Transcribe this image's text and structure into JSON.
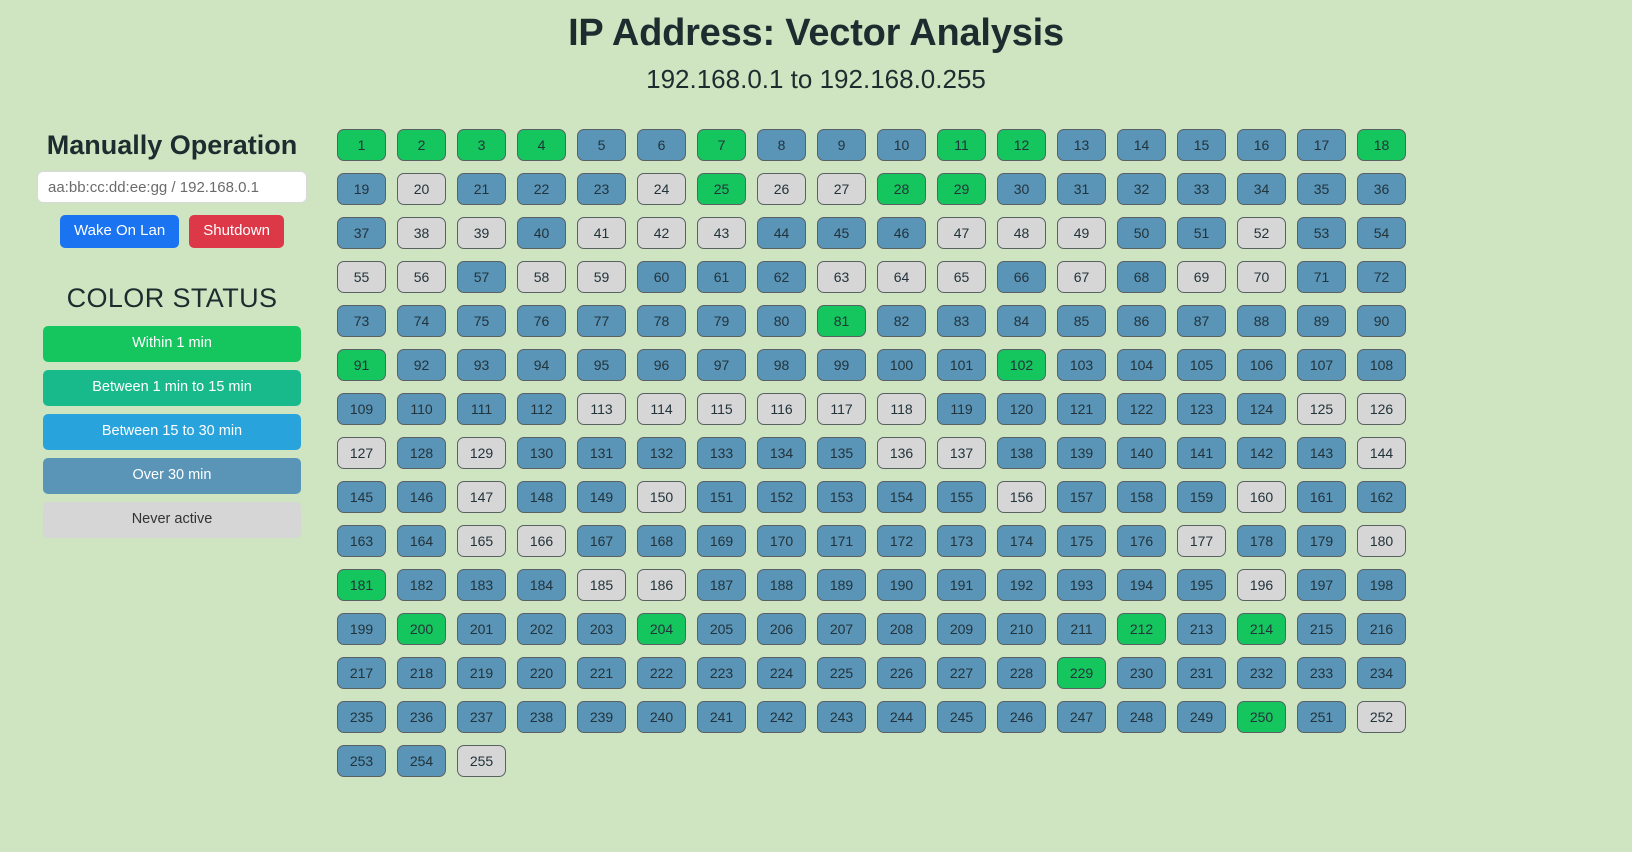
{
  "header": {
    "title": "IP Address: Vector Analysis",
    "subtitle": "192.168.0.1 to 192.168.0.255"
  },
  "sidebar": {
    "manual_title": "Manually Operation",
    "mac_input": {
      "placeholder": "aa:bb:cc:dd:ee:gg / 192.168.0.1",
      "value": ""
    },
    "wake_on_lan_label": "Wake On Lan",
    "shutdown_label": "Shutdown",
    "status_title": "COLOR STATUS",
    "legend": [
      {
        "label": "Within 1 min",
        "color": "#15c55e",
        "key": "within1"
      },
      {
        "label": "Between 1 min to 15 min",
        "color": "#18b98b",
        "key": "between1_15"
      },
      {
        "label": "Between 15 to 30 min",
        "color": "#29a3dc",
        "key": "between15_30"
      },
      {
        "label": "Over 30 min",
        "color": "#5a95b8",
        "key": "over30"
      },
      {
        "label": "Never active",
        "color": "#d6d6d6",
        "key": "never"
      }
    ]
  },
  "grid": {
    "columns": 18,
    "first": 1,
    "last": 255,
    "colors": {
      "within1": "#15c55e",
      "between1_15": "#18b98b",
      "between15_30": "#29a3dc",
      "over30": "#5a95b8",
      "never": "#d6d6d6"
    },
    "cells": [
      {
        "n": 1,
        "s": "within1"
      },
      {
        "n": 2,
        "s": "within1"
      },
      {
        "n": 3,
        "s": "within1"
      },
      {
        "n": 4,
        "s": "within1"
      },
      {
        "n": 5,
        "s": "over30"
      },
      {
        "n": 6,
        "s": "over30"
      },
      {
        "n": 7,
        "s": "within1"
      },
      {
        "n": 8,
        "s": "over30"
      },
      {
        "n": 9,
        "s": "over30"
      },
      {
        "n": 10,
        "s": "over30"
      },
      {
        "n": 11,
        "s": "within1"
      },
      {
        "n": 12,
        "s": "within1"
      },
      {
        "n": 13,
        "s": "over30"
      },
      {
        "n": 14,
        "s": "over30"
      },
      {
        "n": 15,
        "s": "over30"
      },
      {
        "n": 16,
        "s": "over30"
      },
      {
        "n": 17,
        "s": "over30"
      },
      {
        "n": 18,
        "s": "within1"
      },
      {
        "n": 19,
        "s": "over30"
      },
      {
        "n": 20,
        "s": "never"
      },
      {
        "n": 21,
        "s": "over30"
      },
      {
        "n": 22,
        "s": "over30"
      },
      {
        "n": 23,
        "s": "over30"
      },
      {
        "n": 24,
        "s": "never"
      },
      {
        "n": 25,
        "s": "within1"
      },
      {
        "n": 26,
        "s": "never"
      },
      {
        "n": 27,
        "s": "never"
      },
      {
        "n": 28,
        "s": "within1"
      },
      {
        "n": 29,
        "s": "within1"
      },
      {
        "n": 30,
        "s": "over30"
      },
      {
        "n": 31,
        "s": "over30"
      },
      {
        "n": 32,
        "s": "over30"
      },
      {
        "n": 33,
        "s": "over30"
      },
      {
        "n": 34,
        "s": "over30"
      },
      {
        "n": 35,
        "s": "over30"
      },
      {
        "n": 36,
        "s": "over30"
      },
      {
        "n": 37,
        "s": "over30"
      },
      {
        "n": 38,
        "s": "never"
      },
      {
        "n": 39,
        "s": "never"
      },
      {
        "n": 40,
        "s": "over30"
      },
      {
        "n": 41,
        "s": "never"
      },
      {
        "n": 42,
        "s": "never"
      },
      {
        "n": 43,
        "s": "never"
      },
      {
        "n": 44,
        "s": "over30"
      },
      {
        "n": 45,
        "s": "over30"
      },
      {
        "n": 46,
        "s": "over30"
      },
      {
        "n": 47,
        "s": "never"
      },
      {
        "n": 48,
        "s": "never"
      },
      {
        "n": 49,
        "s": "never"
      },
      {
        "n": 50,
        "s": "over30"
      },
      {
        "n": 51,
        "s": "over30"
      },
      {
        "n": 52,
        "s": "never"
      },
      {
        "n": 53,
        "s": "over30"
      },
      {
        "n": 54,
        "s": "over30"
      },
      {
        "n": 55,
        "s": "never"
      },
      {
        "n": 56,
        "s": "never"
      },
      {
        "n": 57,
        "s": "over30"
      },
      {
        "n": 58,
        "s": "never"
      },
      {
        "n": 59,
        "s": "never"
      },
      {
        "n": 60,
        "s": "over30"
      },
      {
        "n": 61,
        "s": "over30"
      },
      {
        "n": 62,
        "s": "over30"
      },
      {
        "n": 63,
        "s": "never"
      },
      {
        "n": 64,
        "s": "never"
      },
      {
        "n": 65,
        "s": "never"
      },
      {
        "n": 66,
        "s": "over30"
      },
      {
        "n": 67,
        "s": "never"
      },
      {
        "n": 68,
        "s": "over30"
      },
      {
        "n": 69,
        "s": "never"
      },
      {
        "n": 70,
        "s": "never"
      },
      {
        "n": 71,
        "s": "over30"
      },
      {
        "n": 72,
        "s": "over30"
      },
      {
        "n": 73,
        "s": "over30"
      },
      {
        "n": 74,
        "s": "over30"
      },
      {
        "n": 75,
        "s": "over30"
      },
      {
        "n": 76,
        "s": "over30"
      },
      {
        "n": 77,
        "s": "over30"
      },
      {
        "n": 78,
        "s": "over30"
      },
      {
        "n": 79,
        "s": "over30"
      },
      {
        "n": 80,
        "s": "over30"
      },
      {
        "n": 81,
        "s": "within1"
      },
      {
        "n": 82,
        "s": "over30"
      },
      {
        "n": 83,
        "s": "over30"
      },
      {
        "n": 84,
        "s": "over30"
      },
      {
        "n": 85,
        "s": "over30"
      },
      {
        "n": 86,
        "s": "over30"
      },
      {
        "n": 87,
        "s": "over30"
      },
      {
        "n": 88,
        "s": "over30"
      },
      {
        "n": 89,
        "s": "over30"
      },
      {
        "n": 90,
        "s": "over30"
      },
      {
        "n": 91,
        "s": "within1"
      },
      {
        "n": 92,
        "s": "over30"
      },
      {
        "n": 93,
        "s": "over30"
      },
      {
        "n": 94,
        "s": "over30"
      },
      {
        "n": 95,
        "s": "over30"
      },
      {
        "n": 96,
        "s": "over30"
      },
      {
        "n": 97,
        "s": "over30"
      },
      {
        "n": 98,
        "s": "over30"
      },
      {
        "n": 99,
        "s": "over30"
      },
      {
        "n": 100,
        "s": "over30"
      },
      {
        "n": 101,
        "s": "over30"
      },
      {
        "n": 102,
        "s": "within1"
      },
      {
        "n": 103,
        "s": "over30"
      },
      {
        "n": 104,
        "s": "over30"
      },
      {
        "n": 105,
        "s": "over30"
      },
      {
        "n": 106,
        "s": "over30"
      },
      {
        "n": 107,
        "s": "over30"
      },
      {
        "n": 108,
        "s": "over30"
      },
      {
        "n": 109,
        "s": "over30"
      },
      {
        "n": 110,
        "s": "over30"
      },
      {
        "n": 111,
        "s": "over30"
      },
      {
        "n": 112,
        "s": "over30"
      },
      {
        "n": 113,
        "s": "never"
      },
      {
        "n": 114,
        "s": "never"
      },
      {
        "n": 115,
        "s": "never"
      },
      {
        "n": 116,
        "s": "never"
      },
      {
        "n": 117,
        "s": "never"
      },
      {
        "n": 118,
        "s": "never"
      },
      {
        "n": 119,
        "s": "over30"
      },
      {
        "n": 120,
        "s": "over30"
      },
      {
        "n": 121,
        "s": "over30"
      },
      {
        "n": 122,
        "s": "over30"
      },
      {
        "n": 123,
        "s": "over30"
      },
      {
        "n": 124,
        "s": "over30"
      },
      {
        "n": 125,
        "s": "never"
      },
      {
        "n": 126,
        "s": "never"
      },
      {
        "n": 127,
        "s": "never"
      },
      {
        "n": 128,
        "s": "over30"
      },
      {
        "n": 129,
        "s": "never"
      },
      {
        "n": 130,
        "s": "over30"
      },
      {
        "n": 131,
        "s": "over30"
      },
      {
        "n": 132,
        "s": "over30"
      },
      {
        "n": 133,
        "s": "over30"
      },
      {
        "n": 134,
        "s": "over30"
      },
      {
        "n": 135,
        "s": "over30"
      },
      {
        "n": 136,
        "s": "never"
      },
      {
        "n": 137,
        "s": "never"
      },
      {
        "n": 138,
        "s": "over30"
      },
      {
        "n": 139,
        "s": "over30"
      },
      {
        "n": 140,
        "s": "over30"
      },
      {
        "n": 141,
        "s": "over30"
      },
      {
        "n": 142,
        "s": "over30"
      },
      {
        "n": 143,
        "s": "over30"
      },
      {
        "n": 144,
        "s": "never"
      },
      {
        "n": 145,
        "s": "over30"
      },
      {
        "n": 146,
        "s": "over30"
      },
      {
        "n": 147,
        "s": "never"
      },
      {
        "n": 148,
        "s": "over30"
      },
      {
        "n": 149,
        "s": "over30"
      },
      {
        "n": 150,
        "s": "never"
      },
      {
        "n": 151,
        "s": "over30"
      },
      {
        "n": 152,
        "s": "over30"
      },
      {
        "n": 153,
        "s": "over30"
      },
      {
        "n": 154,
        "s": "over30"
      },
      {
        "n": 155,
        "s": "over30"
      },
      {
        "n": 156,
        "s": "never"
      },
      {
        "n": 157,
        "s": "over30"
      },
      {
        "n": 158,
        "s": "over30"
      },
      {
        "n": 159,
        "s": "over30"
      },
      {
        "n": 160,
        "s": "never"
      },
      {
        "n": 161,
        "s": "over30"
      },
      {
        "n": 162,
        "s": "over30"
      },
      {
        "n": 163,
        "s": "over30"
      },
      {
        "n": 164,
        "s": "over30"
      },
      {
        "n": 165,
        "s": "never"
      },
      {
        "n": 166,
        "s": "never"
      },
      {
        "n": 167,
        "s": "over30"
      },
      {
        "n": 168,
        "s": "over30"
      },
      {
        "n": 169,
        "s": "over30"
      },
      {
        "n": 170,
        "s": "over30"
      },
      {
        "n": 171,
        "s": "over30"
      },
      {
        "n": 172,
        "s": "over30"
      },
      {
        "n": 173,
        "s": "over30"
      },
      {
        "n": 174,
        "s": "over30"
      },
      {
        "n": 175,
        "s": "over30"
      },
      {
        "n": 176,
        "s": "over30"
      },
      {
        "n": 177,
        "s": "never"
      },
      {
        "n": 178,
        "s": "over30"
      },
      {
        "n": 179,
        "s": "over30"
      },
      {
        "n": 180,
        "s": "never"
      },
      {
        "n": 181,
        "s": "within1"
      },
      {
        "n": 182,
        "s": "over30"
      },
      {
        "n": 183,
        "s": "over30"
      },
      {
        "n": 184,
        "s": "over30"
      },
      {
        "n": 185,
        "s": "never"
      },
      {
        "n": 186,
        "s": "never"
      },
      {
        "n": 187,
        "s": "over30"
      },
      {
        "n": 188,
        "s": "over30"
      },
      {
        "n": 189,
        "s": "over30"
      },
      {
        "n": 190,
        "s": "over30"
      },
      {
        "n": 191,
        "s": "over30"
      },
      {
        "n": 192,
        "s": "over30"
      },
      {
        "n": 193,
        "s": "over30"
      },
      {
        "n": 194,
        "s": "over30"
      },
      {
        "n": 195,
        "s": "over30"
      },
      {
        "n": 196,
        "s": "never"
      },
      {
        "n": 197,
        "s": "over30"
      },
      {
        "n": 198,
        "s": "over30"
      },
      {
        "n": 199,
        "s": "over30"
      },
      {
        "n": 200,
        "s": "within1"
      },
      {
        "n": 201,
        "s": "over30"
      },
      {
        "n": 202,
        "s": "over30"
      },
      {
        "n": 203,
        "s": "over30"
      },
      {
        "n": 204,
        "s": "within1"
      },
      {
        "n": 205,
        "s": "over30"
      },
      {
        "n": 206,
        "s": "over30"
      },
      {
        "n": 207,
        "s": "over30"
      },
      {
        "n": 208,
        "s": "over30"
      },
      {
        "n": 209,
        "s": "over30"
      },
      {
        "n": 210,
        "s": "over30"
      },
      {
        "n": 211,
        "s": "over30"
      },
      {
        "n": 212,
        "s": "within1"
      },
      {
        "n": 213,
        "s": "over30"
      },
      {
        "n": 214,
        "s": "within1"
      },
      {
        "n": 215,
        "s": "over30"
      },
      {
        "n": 216,
        "s": "over30"
      },
      {
        "n": 217,
        "s": "over30"
      },
      {
        "n": 218,
        "s": "over30"
      },
      {
        "n": 219,
        "s": "over30"
      },
      {
        "n": 220,
        "s": "over30"
      },
      {
        "n": 221,
        "s": "over30"
      },
      {
        "n": 222,
        "s": "over30"
      },
      {
        "n": 223,
        "s": "over30"
      },
      {
        "n": 224,
        "s": "over30"
      },
      {
        "n": 225,
        "s": "over30"
      },
      {
        "n": 226,
        "s": "over30"
      },
      {
        "n": 227,
        "s": "over30"
      },
      {
        "n": 228,
        "s": "over30"
      },
      {
        "n": 229,
        "s": "within1"
      },
      {
        "n": 230,
        "s": "over30"
      },
      {
        "n": 231,
        "s": "over30"
      },
      {
        "n": 232,
        "s": "over30"
      },
      {
        "n": 233,
        "s": "over30"
      },
      {
        "n": 234,
        "s": "over30"
      },
      {
        "n": 235,
        "s": "over30"
      },
      {
        "n": 236,
        "s": "over30"
      },
      {
        "n": 237,
        "s": "over30"
      },
      {
        "n": 238,
        "s": "over30"
      },
      {
        "n": 239,
        "s": "over30"
      },
      {
        "n": 240,
        "s": "over30"
      },
      {
        "n": 241,
        "s": "over30"
      },
      {
        "n": 242,
        "s": "over30"
      },
      {
        "n": 243,
        "s": "over30"
      },
      {
        "n": 244,
        "s": "over30"
      },
      {
        "n": 245,
        "s": "over30"
      },
      {
        "n": 246,
        "s": "over30"
      },
      {
        "n": 247,
        "s": "over30"
      },
      {
        "n": 248,
        "s": "over30"
      },
      {
        "n": 249,
        "s": "over30"
      },
      {
        "n": 250,
        "s": "within1"
      },
      {
        "n": 251,
        "s": "over30"
      },
      {
        "n": 252,
        "s": "never"
      },
      {
        "n": 253,
        "s": "over30"
      },
      {
        "n": 254,
        "s": "over30"
      },
      {
        "n": 255,
        "s": "never"
      }
    ]
  }
}
